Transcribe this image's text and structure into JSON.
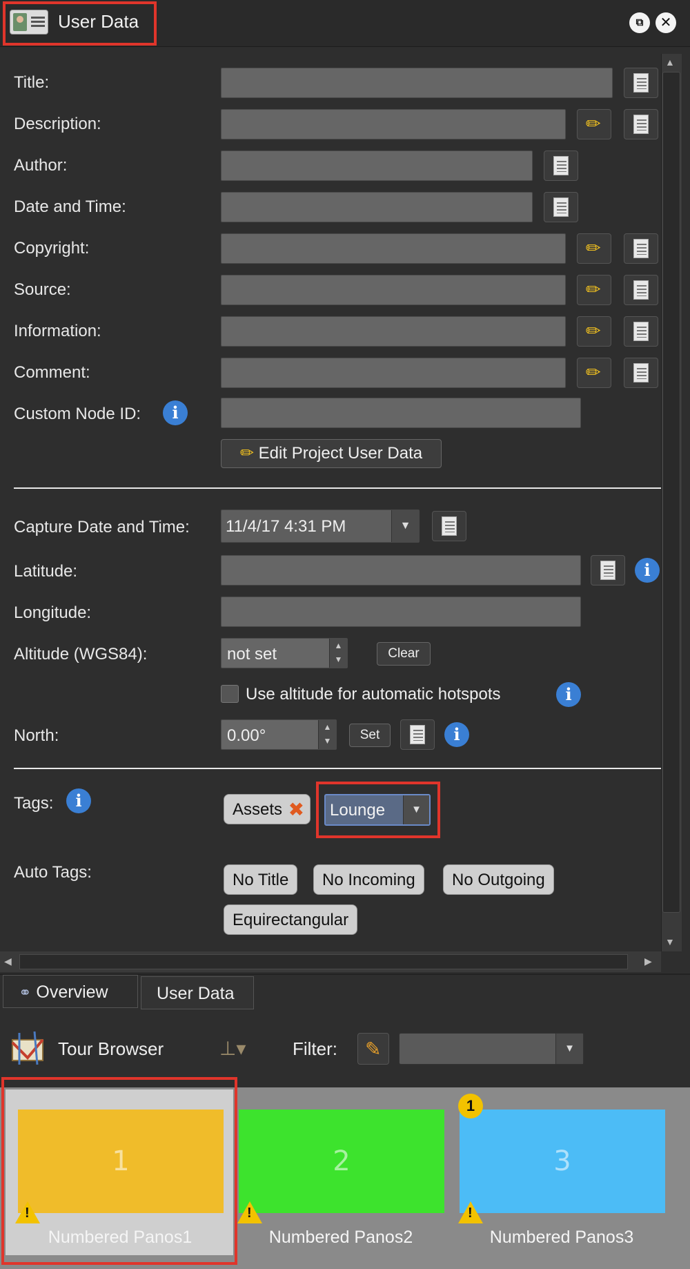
{
  "window": {
    "title": "User Data",
    "restore_glyph": "⧉",
    "close_glyph": "✕"
  },
  "fields": [
    {
      "label": "Title:"
    },
    {
      "label": "Description:"
    },
    {
      "label": "Author:"
    },
    {
      "label": "Date and Time:"
    },
    {
      "label": "Copyright:"
    },
    {
      "label": "Source:"
    },
    {
      "label": "Information:"
    },
    {
      "label": "Comment:"
    },
    {
      "label": "Custom Node ID:"
    }
  ],
  "edit_project_button": "Edit Project User Data",
  "capture": {
    "label": "Capture Date and Time:",
    "value": "11/4/17 4:31 PM"
  },
  "latitude": {
    "label": "Latitude:"
  },
  "longitude": {
    "label": "Longitude:"
  },
  "altitude": {
    "label": "Altitude (WGS84):",
    "value": "not set",
    "clear": "Clear"
  },
  "use_altitude": {
    "label": "Use altitude for automatic hotspots"
  },
  "north": {
    "label": "North:",
    "value": "0.00°",
    "set": "Set"
  },
  "tags": {
    "label": "Tags:",
    "items": [
      "Assets"
    ],
    "dropdown_value": "Lounge"
  },
  "auto_tags": {
    "label": "Auto Tags:",
    "items": [
      "No Title",
      "No Incoming",
      "No Outgoing",
      "Equirectangular"
    ]
  },
  "tabs": [
    {
      "label": "Overview",
      "icon": "binoculars-icon"
    },
    {
      "label": "User Data"
    }
  ],
  "tour_browser": {
    "title": "Tour Browser",
    "filter_label": "Filter:"
  },
  "panos": [
    {
      "number": "1",
      "label": "Numbered Panos1",
      "color": "#f0bc2a",
      "selected": true
    },
    {
      "number": "2",
      "label": "Numbered Panos2",
      "color": "#3de32d"
    },
    {
      "number": "3",
      "label": "Numbered Panos3",
      "color": "#4cbcf6",
      "badge": "1"
    }
  ],
  "colors": {
    "highlight": "#e0352b",
    "info": "#3a7fd4",
    "field": "#666666"
  }
}
